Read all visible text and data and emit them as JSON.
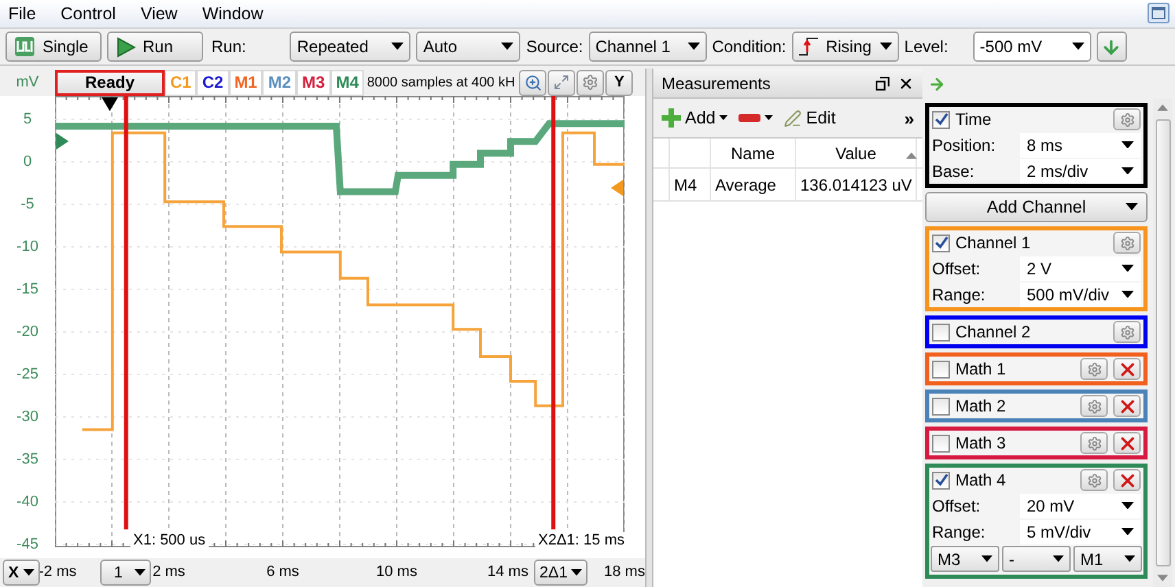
{
  "menu": [
    {
      "label": "File"
    },
    {
      "label": "Control"
    },
    {
      "label": "View"
    },
    {
      "label": "Window"
    }
  ],
  "toolbar": {
    "single_button": "Single",
    "run_button": "Run",
    "run_label": "Run:",
    "run_mode": "Repeated",
    "trigger_mode": "Auto",
    "source_label": "Source:",
    "source": "Channel 1",
    "condition_label": "Condition:",
    "condition": "Rising",
    "level_label": "Level:",
    "level_value": "-500 mV"
  },
  "scope": {
    "unit": "mV",
    "status": "Ready",
    "tabs": [
      {
        "label": "C1",
        "color": "#f39a1e"
      },
      {
        "label": "C2",
        "color": "#1a1ad0"
      },
      {
        "label": "M1",
        "color": "#f26522"
      },
      {
        "label": "M2",
        "color": "#5a8fc0"
      },
      {
        "label": "M3",
        "color": "#d4213d"
      },
      {
        "label": "M4",
        "color": "#2e8b57"
      }
    ],
    "sample_info": "8000 samples at 400 kH",
    "y_button": "Y",
    "x_axis_button": "X",
    "cursor_1_selector": "1",
    "cursor_2_selector": "2Δ1",
    "cursor_1_label": "X1: 500 us",
    "cursor_2_label": "X2Δ1: 15 ms",
    "chart_data": {
      "type": "line",
      "xlim": [
        -2,
        18
      ],
      "ylim": [
        -45,
        5
      ],
      "grid": true,
      "ref_lines": [
        {
          "axis": "x",
          "value": 0.5,
          "color": "#e01010"
        },
        {
          "axis": "x",
          "value": 15.5,
          "color": "#e01010"
        }
      ],
      "x": [
        -2,
        -1.04,
        0.02,
        0.02,
        1.86,
        1.86,
        3.93,
        3.93,
        5.95,
        5.95,
        7.88,
        8.02,
        8.02,
        8.99,
        8.99,
        9.95,
        10.05,
        11.98,
        11.98,
        12.94,
        12.94,
        14.0,
        14.0,
        14.87,
        14.87,
        15.35,
        15.83,
        15.83,
        16.94,
        16.94,
        18
      ],
      "series": [
        {
          "color": "#f5a33a",
          "values": [
            null,
            -31.5,
            -31.5,
            3.4,
            3.4,
            -4.7,
            -4.7,
            -7.6,
            -7.6,
            -10.6,
            -10.6,
            -10.6,
            -13.7,
            -13.7,
            -16.8,
            -16.8,
            -16.8,
            -16.8,
            -19.7,
            -19.7,
            -22.9,
            -22.9,
            -25.8,
            -25.8,
            -28.7,
            -28.7,
            -28.7,
            3.4,
            3.4,
            -0.3,
            -0.3
          ]
        },
        {
          "color": "#5aa87c",
          "values": [
            4.2,
            4.2,
            4.2,
            4.2,
            4.2,
            4.2,
            4.2,
            4.2,
            4.2,
            4.2,
            4.2,
            -3.5,
            -3.5,
            -3.5,
            -3.5,
            -3.5,
            -1.6,
            -1.6,
            -0.3,
            -0.3,
            1.0,
            1.0,
            2.4,
            2.4,
            2.4,
            4.5,
            4.5,
            4.5,
            4.5,
            4.5,
            4.5
          ]
        }
      ],
      "xticks": [
        {
          "value": -2,
          "label": "-2 ms"
        },
        {
          "value": 2,
          "label": "2 ms"
        },
        {
          "value": 6,
          "label": "6 ms"
        },
        {
          "value": 10,
          "label": "10 ms"
        },
        {
          "value": 14,
          "label": "14 ms"
        },
        {
          "value": 18,
          "label": "18 ms"
        }
      ],
      "yticks": [
        {
          "value": 5,
          "label": "5"
        },
        {
          "value": 0,
          "label": "0"
        },
        {
          "value": -5,
          "label": "-5"
        },
        {
          "value": -10,
          "label": "-10"
        },
        {
          "value": -15,
          "label": "-15"
        },
        {
          "value": -20,
          "label": "-20"
        },
        {
          "value": -25,
          "label": "-25"
        },
        {
          "value": -30,
          "label": "-30"
        },
        {
          "value": -35,
          "label": "-35"
        },
        {
          "value": -40,
          "label": "-40"
        },
        {
          "value": -45,
          "label": "-45"
        }
      ]
    }
  },
  "measurements": {
    "title": "Measurements",
    "add_button": "Add",
    "edit_button": "Edit",
    "overflow": "»",
    "columns": [
      "Name",
      "Value"
    ],
    "rows": [
      {
        "column_1": "M4",
        "name": "Average",
        "value": "136.014123 uV"
      }
    ]
  },
  "channel_panel": {
    "items": [
      {
        "kind": "group",
        "label": "Time",
        "checked": true,
        "color": "#000000",
        "removable": false,
        "fields": [
          {
            "label": "Position:",
            "value": "8 ms"
          },
          {
            "label": "Base:",
            "value": "2 ms/div"
          }
        ]
      },
      {
        "kind": "button",
        "label": "Add Channel"
      },
      {
        "kind": "group",
        "label": "Channel 1",
        "checked": true,
        "color": "#f7941d",
        "removable": false,
        "fields": [
          {
            "label": "Offset:",
            "value": "2 V"
          },
          {
            "label": "Range:",
            "value": "500 mV/div"
          }
        ]
      },
      {
        "kind": "group",
        "label": "Channel 2",
        "checked": false,
        "color": "#0000f0",
        "removable": false
      },
      {
        "kind": "group",
        "label": "Math 1",
        "checked": false,
        "color": "#f2601e",
        "removable": true
      },
      {
        "kind": "group",
        "label": "Math 2",
        "checked": false,
        "color": "#4b82b8",
        "removable": true
      },
      {
        "kind": "group",
        "label": "Math 3",
        "checked": false,
        "color": "#d61a42",
        "removable": true
      },
      {
        "kind": "group",
        "label": "Math 4",
        "checked": true,
        "color": "#2e8b57",
        "removable": true,
        "fields": [
          {
            "label": "Offset:",
            "value": "20 mV"
          },
          {
            "label": "Range:",
            "value": "5 mV/div"
          }
        ],
        "operands": [
          "M3",
          "-",
          "M1"
        ]
      }
    ]
  }
}
